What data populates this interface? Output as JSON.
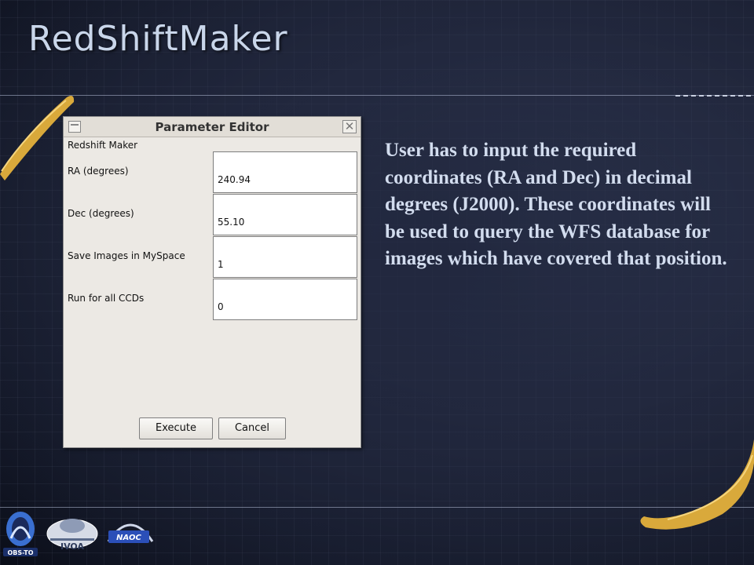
{
  "slide": {
    "title": "RedShiftMaker",
    "description": "User has to input the required coordinates (RA and Dec) in decimal degrees (J2000). These coordinates will be used to query the WFS database for images which have covered that position."
  },
  "dialog": {
    "title": "Parameter Editor",
    "heading": "Redshift Maker",
    "close_icon": "close-icon",
    "menu_icon": "window-menu-icon",
    "params": [
      {
        "label": "RA (degrees)",
        "value": "240.94"
      },
      {
        "label": "Dec (degrees)",
        "value": "55.10"
      },
      {
        "label": "Save Images in MySpace",
        "value": "1"
      },
      {
        "label": "Run for all CCDs",
        "value": "0"
      }
    ],
    "execute_label": "Execute",
    "cancel_label": "Cancel"
  },
  "logos": {
    "left": "OBS-TO",
    "middle": "IVOA",
    "right": "NAOC"
  },
  "colors": {
    "background": "#1e2438",
    "title_text": "#c9d6ea",
    "body_text": "#d2dcee",
    "swoosh": "#d9a93b"
  }
}
